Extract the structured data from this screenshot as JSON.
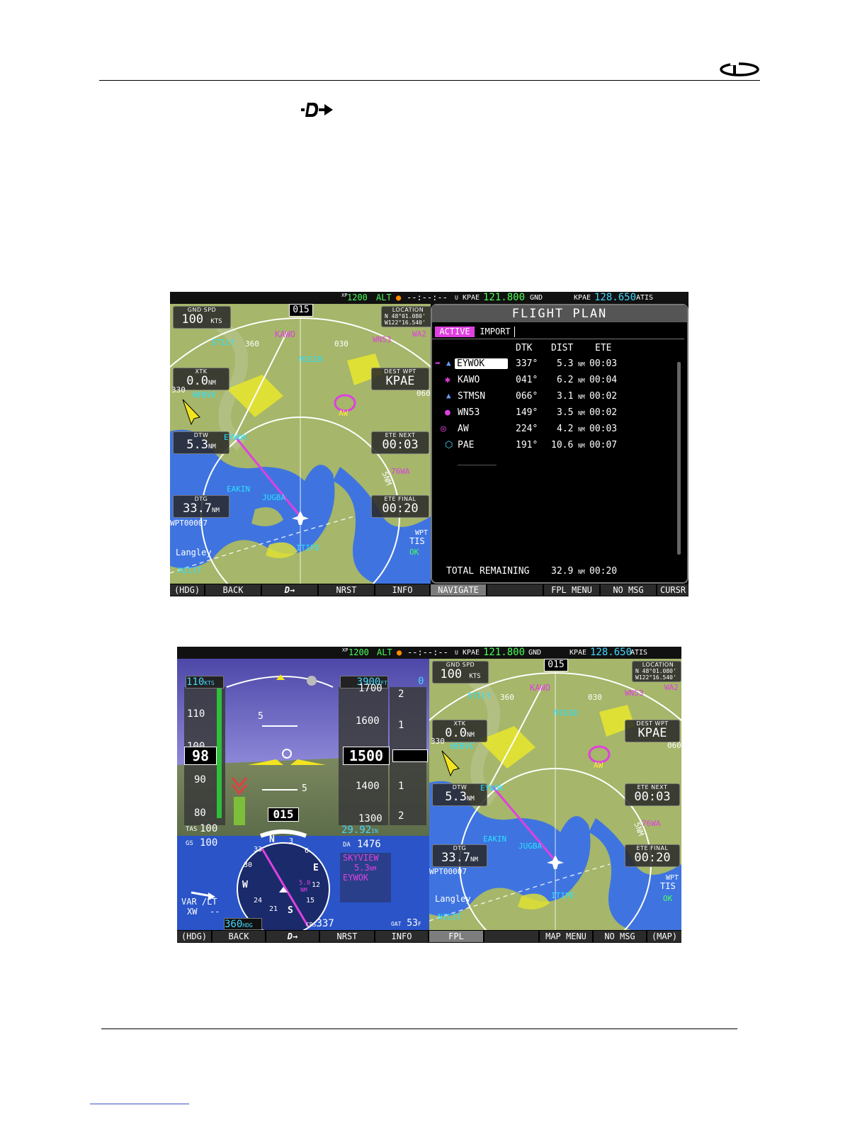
{
  "header": {
    "logo_icon": "dynon-logo-icon"
  },
  "direct_to_icon": "direct-to-icon",
  "screen1": {
    "topbar": {
      "xpdr": "XP",
      "squawk": "1200",
      "mode": "ALT",
      "timer": "--:--:--",
      "u": "U",
      "com1_ident": "KPAE",
      "com1_freq": "121.800",
      "com1_type": "GND",
      "com2_ident": "KPAE",
      "com2_freq": "128.650",
      "com2_type": "ATIS"
    },
    "map": {
      "gnd_spd_label": "GND SPD",
      "gnd_spd_value": "100",
      "gnd_spd_unit": "KTS",
      "hdg_bug": "015",
      "location_label": "LOCATION",
      "lat": "N 48°01.080'",
      "lon": "W122°16.540'",
      "xtk_label": "XTK",
      "xtk_value": "0.0",
      "xtk_unit": "NM",
      "dest_label": "DEST WPT",
      "dest_value": "KPAE",
      "dtw_label": "DTW",
      "dtw_value": "5.3",
      "dtw_unit": "NM",
      "ete_next_label": "ETE NEXT",
      "ete_next_value": "00:03",
      "dtg_label": "DTG",
      "dtg_value": "33.7",
      "dtg_unit": "NM",
      "ete_final_label": "ETE FINAL",
      "ete_final_value": "00:20",
      "compass_360": "360",
      "compass_030": "030",
      "compass_330": "330",
      "compass_060": "060",
      "labels": {
        "stily": "STILY",
        "kawo": "KAWO",
        "wn53": "WN53",
        "wa2": "WA2",
        "migib": "MIGIB",
        "webve": "WEBVE",
        "eywok": "EYWOK",
        "eakin": "EAKIN",
        "jugba": "JUGBA",
        "wpt": "WPT00007",
        "langley": "Langley",
        "nicit": "NICIT",
        "itipe": "ITIPE",
        "wa76": "76WA",
        "aw": "AW",
        "range": "5NM",
        "wpt_tis": "WPT",
        "tis": "TIS",
        "ok": "OK"
      }
    },
    "fpl": {
      "title": "FLIGHT PLAN",
      "tab_active": "ACTIVE",
      "tab_import": "IMPORT",
      "col_dtk": "DTK",
      "col_dist": "DIST",
      "col_ete": "ETE",
      "rows": [
        {
          "wpt": "EYWOK",
          "dtk": "337°",
          "dist": "5.3",
          "unit": "NM",
          "ete": "00:03",
          "icon": "intersection-icon",
          "active": true
        },
        {
          "wpt": "KAWO",
          "dtk": "041°",
          "dist": "6.2",
          "unit": "NM",
          "ete": "00:04",
          "icon": "airport-icon",
          "active": false
        },
        {
          "wpt": "STMSN",
          "dtk": "066°",
          "dist": "3.1",
          "unit": "NM",
          "ete": "00:02",
          "icon": "intersection-icon",
          "active": false
        },
        {
          "wpt": "WN53",
          "dtk": "149°",
          "dist": "3.5",
          "unit": "NM",
          "ete": "00:02",
          "icon": "private-airport-icon",
          "active": false
        },
        {
          "wpt": "AW",
          "dtk": "224°",
          "dist": "4.2",
          "unit": "NM",
          "ete": "00:03",
          "icon": "ndb-icon",
          "active": false
        },
        {
          "wpt": "PAE",
          "dtk": "191°",
          "dist": "10.6",
          "unit": "NM",
          "ete": "00:07",
          "icon": "vor-icon",
          "active": false
        }
      ],
      "empty_row": "_______",
      "total_label": "TOTAL REMAINING",
      "total_dist": "32.9",
      "total_unit": "NM",
      "total_ete": "00:20"
    },
    "softkeys": [
      "(HDG)",
      "BACK",
      "D→",
      "NRST",
      "INFO",
      "NAVIGATE",
      "",
      "FPL MENU",
      "NO MSG",
      "CURSR"
    ]
  },
  "screen2": {
    "topbar": {
      "xpdr": "XP",
      "squawk": "1200",
      "mode": "ALT",
      "timer": "--:--:--",
      "u": "U",
      "com1_ident": "KPAE",
      "com1_freq": "121.800",
      "com1_type": "GND",
      "com2_ident": "KPAE",
      "com2_freq": "128.650",
      "com2_type": "ATIS"
    },
    "efis": {
      "ias_bug": "110",
      "ias_bug_unit": "KTS",
      "ias_ticks": [
        "110",
        "100",
        "90",
        "80"
      ],
      "ias_value": "98",
      "tas_label": "TAS",
      "tas_value": "100",
      "gs_label": "GS",
      "gs_value": "100",
      "alt_bug": "3900",
      "alt_bug_unit": "FT",
      "alt_ticks": [
        "1700",
        "1600",
        "1500",
        "1400",
        "1300"
      ],
      "alt_value": "1500",
      "vsi_bug": "0",
      "vsi_ticks": [
        "2",
        "1",
        "1",
        "2"
      ],
      "baro": "29.92",
      "baro_unit": "IN",
      "da_label": "DA",
      "da_value": "1476",
      "pitch_5": "5",
      "pitch_5b": "5",
      "hdg_value": "015",
      "nav_source": "SKYVIEW",
      "nav_dist": "5.3",
      "nav_dist_unit": "NM",
      "nav_wpt": "EYWOK",
      "hsi_dist": "5.0",
      "hsi_unit": "NM",
      "var_label": "VAR /LT",
      "xw_label": "XW",
      "xw_value": "--",
      "hdg_bug_value": "360",
      "hdg_bug_unit": "HDG",
      "crs_label": "CRS",
      "crs_value": "337",
      "oat_label": "OAT",
      "oat_value": "53",
      "oat_unit": "F",
      "compass_letters": [
        "N",
        "3",
        "6",
        "E",
        "12",
        "15",
        "S",
        "21",
        "24",
        "W",
        "30",
        "33"
      ]
    },
    "map": {
      "gnd_spd_label": "GND SPD",
      "gnd_spd_value": "100",
      "gnd_spd_unit": "KTS",
      "hdg_bug": "015",
      "location_label": "LOCATION",
      "lat": "N 48°01.080'",
      "lon": "W122°16.540'",
      "xtk_label": "XTK",
      "xtk_value": "0.0",
      "xtk_unit": "NM",
      "dest_label": "DEST WPT",
      "dest_value": "KPAE",
      "dtw_label": "DTW",
      "dtw_value": "5.3",
      "dtw_unit": "NM",
      "ete_next_label": "ETE NEXT",
      "ete_next_value": "00:03",
      "dtg_label": "DTG",
      "dtg_value": "33.7",
      "dtg_unit": "NM",
      "ete_final_label": "ETE FINAL",
      "ete_final_value": "00:20",
      "compass_360": "360",
      "compass_030": "030",
      "compass_330": "330",
      "compass_060": "060",
      "labels": {
        "stily": "STILY",
        "kawo": "KAWO",
        "wn53": "WN53",
        "wa2": "WA2",
        "migib": "MIGIB",
        "webve": "WEBVE",
        "eywok": "EYWOK",
        "eakin": "EAKIN",
        "jugba": "JUGBA",
        "wpt": "WPT00007",
        "langley": "Langley",
        "nicit": "NICIT",
        "itipe": "ITIPE",
        "wa76": "76WA",
        "aw": "AW",
        "range": "5NM",
        "wpt_tis": "WPT",
        "tis": "TIS",
        "ok": "OK"
      }
    },
    "softkeys": [
      "(HDG)",
      "BACK",
      "D→",
      "NRST",
      "INFO",
      "FPL",
      "",
      "MAP MENU",
      "NO MSG",
      "(MAP)"
    ]
  },
  "colors": {
    "map_land": "#a6b66a",
    "map_water": "#3f74e0",
    "route": "#e040e0",
    "cyan": "#44d7ff",
    "green": "#4cff5a"
  }
}
